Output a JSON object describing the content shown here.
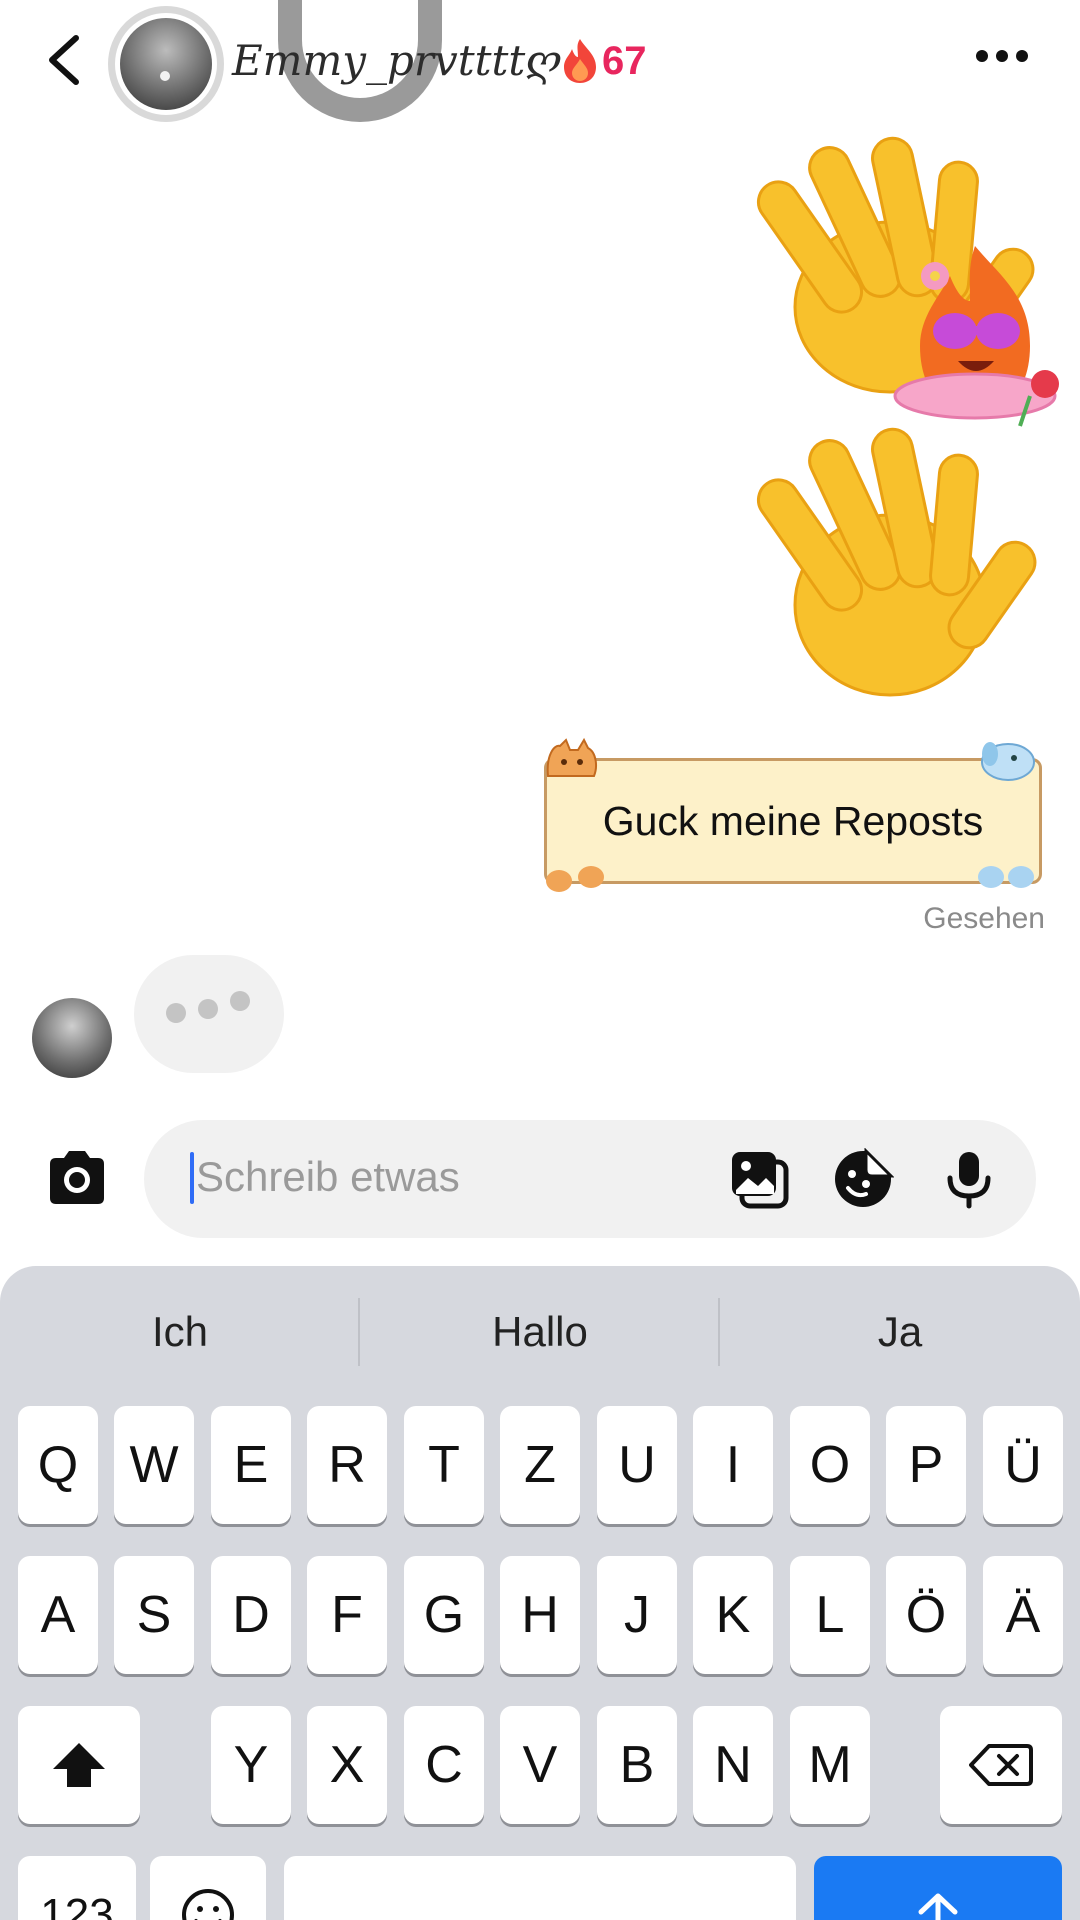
{
  "header": {
    "username": "Emmy_prvttttღ",
    "streak_count": "67"
  },
  "messages": {
    "note_text": "Guck meine Reposts",
    "status": "Gesehen"
  },
  "composer": {
    "placeholder": "Schreib etwas"
  },
  "keyboard": {
    "suggestions": [
      "Ich",
      "Hallo",
      "Ja"
    ],
    "row1": [
      "Q",
      "W",
      "E",
      "R",
      "T",
      "Z",
      "U",
      "I",
      "O",
      "P",
      "Ü"
    ],
    "row2": [
      "A",
      "S",
      "D",
      "F",
      "G",
      "H",
      "J",
      "K",
      "L",
      "Ö",
      "Ä"
    ],
    "row3": [
      "Y",
      "X",
      "C",
      "V",
      "B",
      "N",
      "M"
    ],
    "numbers_label": "123"
  },
  "colors": {
    "streak": "#e8265e",
    "accent": "#1a7af3",
    "caret": "#2f6cf6"
  },
  "icons": [
    "back-chevron-icon",
    "fire-icon",
    "more-icon",
    "camera-icon",
    "gallery-icon",
    "sticker-icon",
    "microphone-icon",
    "shift-icon",
    "backspace-icon",
    "emoji-icon",
    "send-arrow-icon"
  ]
}
